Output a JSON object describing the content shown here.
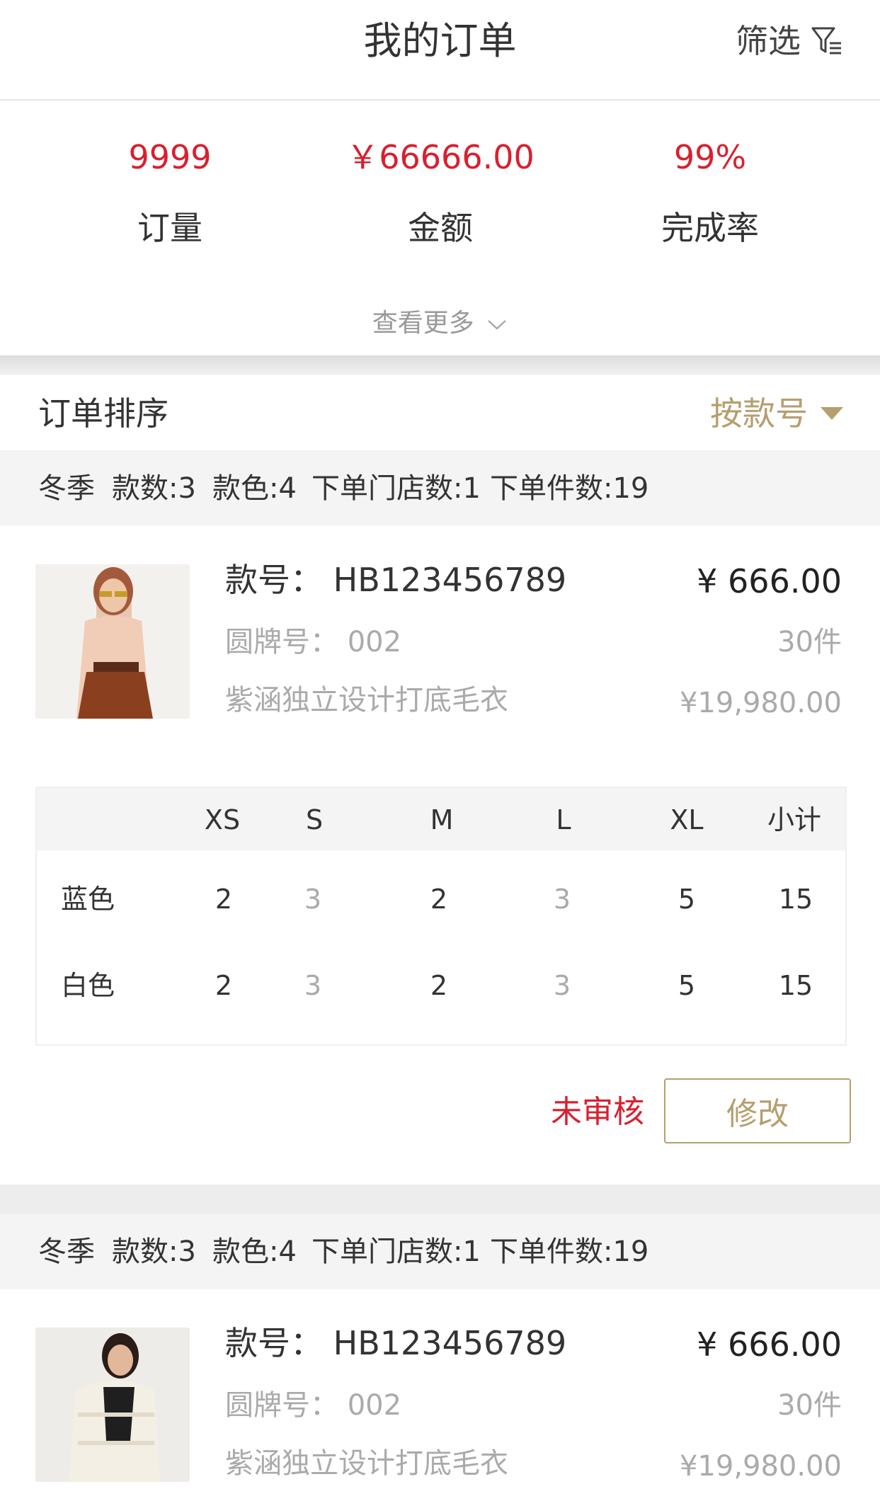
{
  "header": {
    "title": "我的订单",
    "filter_label": "筛选",
    "filter_icon": "filter-icon"
  },
  "summary": {
    "stats": [
      {
        "value": "9999",
        "label": "订量"
      },
      {
        "value": "￥66666.00",
        "label": "金额"
      },
      {
        "value": "99%",
        "label": "完成率"
      }
    ],
    "more_label": "查看更多",
    "more_icon": "chevron-down-icon"
  },
  "sort": {
    "label": "订单排序",
    "value": "按款号",
    "icon": "caret-down-icon"
  },
  "groups": [
    {
      "meta": {
        "season": "冬季",
        "styles": "款数:3",
        "colors": "款色:4",
        "stores": "下单门店数:1",
        "pieces": "下单件数:19"
      },
      "product": {
        "code": "款号：  HB123456789",
        "tag_no": "圆牌号：  002",
        "name": "紫涵独立设计打底毛衣",
        "price": "¥ 666.00",
        "qty": "30件",
        "total": "¥19,980.00"
      },
      "sizes": {
        "headers": [
          "XS",
          "S",
          "M",
          "L",
          "XL",
          "小计"
        ],
        "rows": [
          {
            "color": "蓝色",
            "values": [
              "2",
              "3",
              "2",
              "3",
              "5",
              "15"
            ]
          },
          {
            "color": "白色",
            "values": [
              "2",
              "3",
              "2",
              "3",
              "5",
              "15"
            ]
          }
        ]
      },
      "status": "未审核",
      "edit_label": "修改"
    },
    {
      "meta": {
        "season": "冬季",
        "styles": "款数:3",
        "colors": "款色:4",
        "stores": "下单门店数:1",
        "pieces": "下单件数:19"
      },
      "product": {
        "code": "款号：  HB123456789",
        "tag_no": "圆牌号：  002",
        "name": "紫涵独立设计打底毛衣",
        "price": "¥ 666.00",
        "qty": "30件",
        "total": "¥19,980.00"
      }
    }
  ],
  "colors": {
    "accent_red": "#d8202f",
    "accent_gold": "#b69e6e"
  }
}
